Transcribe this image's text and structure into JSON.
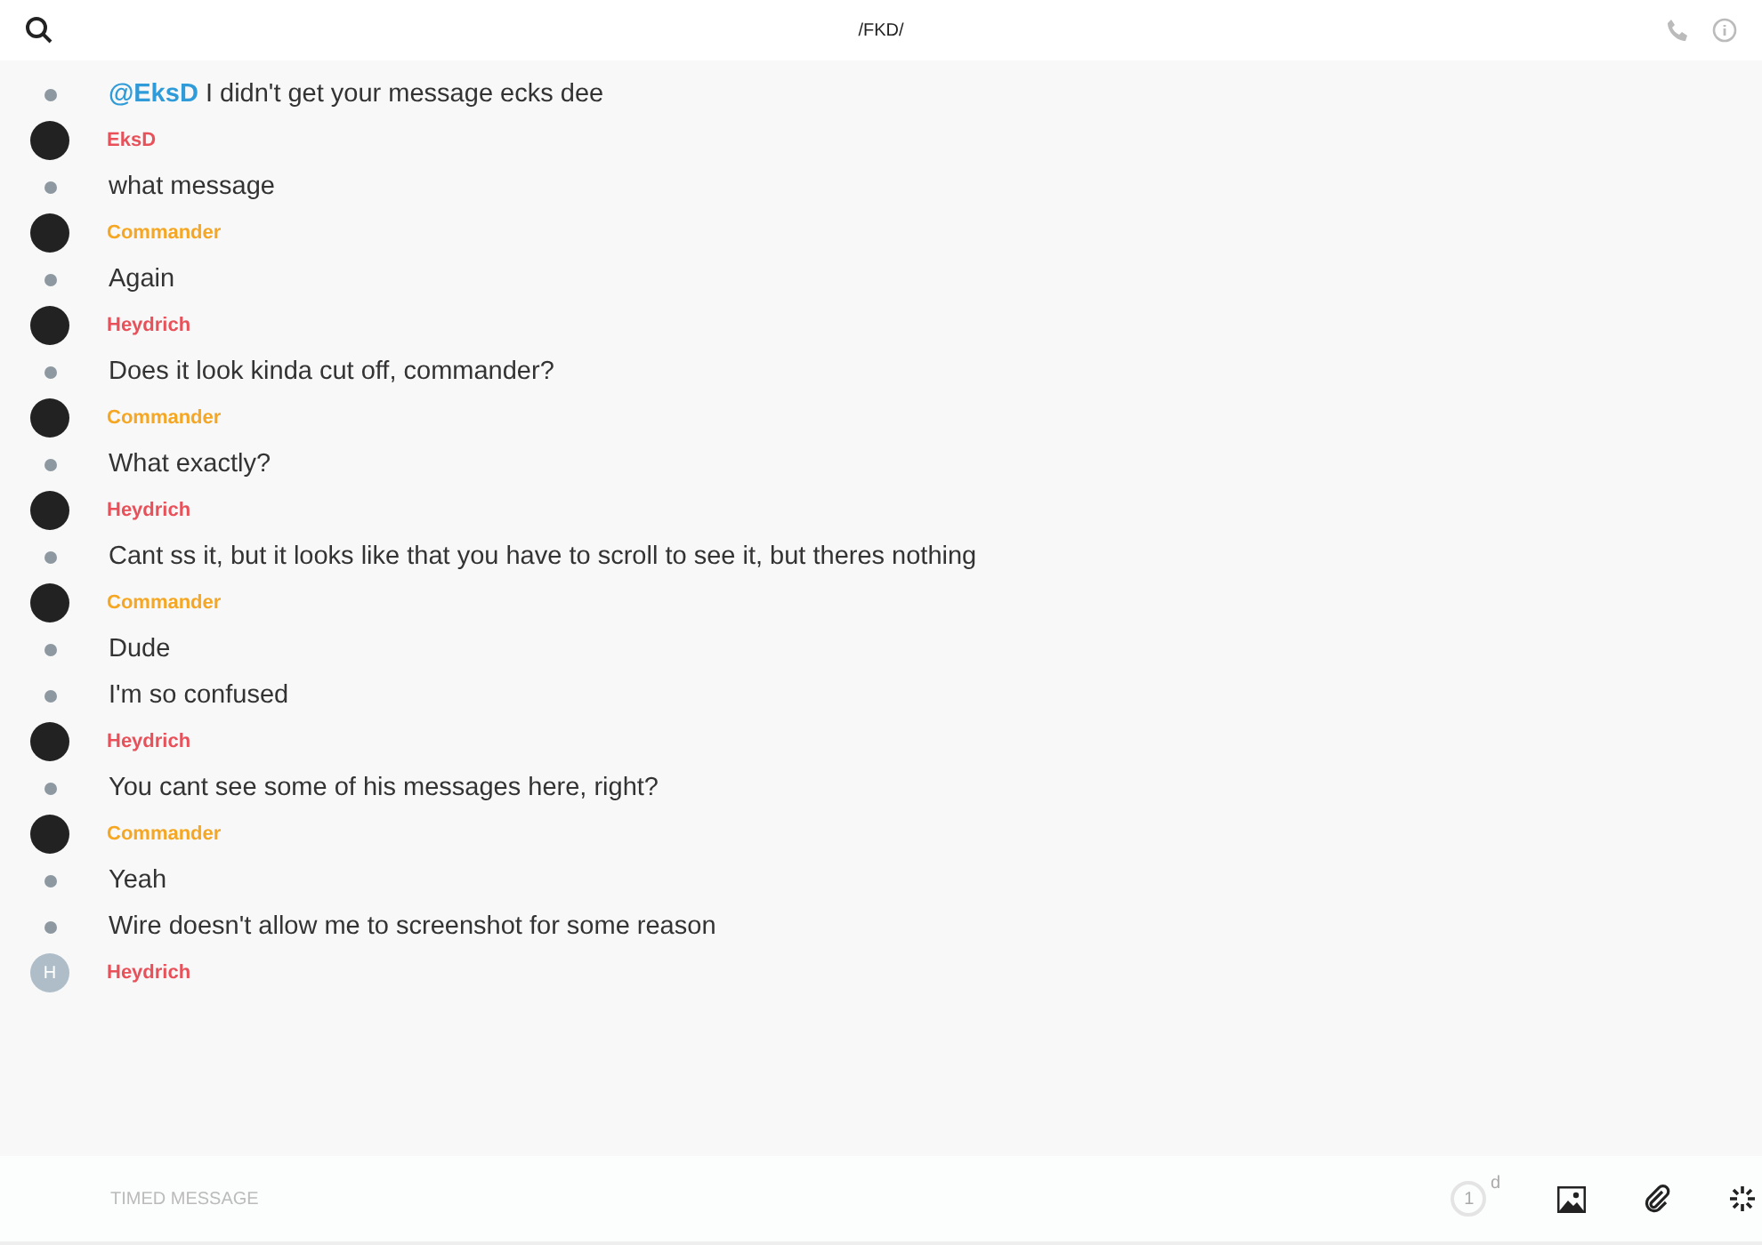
{
  "header": {
    "title": "/FKD/"
  },
  "messages": [
    {
      "mention": "@EksD",
      "text": "I didn't get your message ecks dee"
    },
    {
      "author": {
        "name": "EksD",
        "color": "#e8515a"
      },
      "text": "what message"
    },
    {
      "author": {
        "name": "Commander",
        "color": "#f5a623"
      },
      "text": "Again"
    },
    {
      "author": {
        "name": "Heydrich",
        "color": "#e8515a"
      },
      "text": "Does it look kinda cut off, commander?"
    },
    {
      "author": {
        "name": "Commander",
        "color": "#f5a623"
      },
      "text": "What exactly?"
    },
    {
      "author": {
        "name": "Heydrich",
        "color": "#e8515a"
      },
      "text": "Cant ss it, but it looks like that you have to scroll to see it, but theres nothing"
    },
    {
      "author": {
        "name": "Commander",
        "color": "#f5a623"
      },
      "text": "Dude"
    },
    {
      "text": "I'm so confused"
    },
    {
      "author": {
        "name": "Heydrich",
        "color": "#e8515a"
      },
      "text": "You cant see some of his messages here, right?"
    },
    {
      "author": {
        "name": "Commander",
        "color": "#f5a623"
      },
      "text": "Yeah"
    },
    {
      "text": "Wire doesn't allow me to screenshot for some reason"
    },
    {
      "author": {
        "name": "Heydrich",
        "color": "#e8515a",
        "avatar_letter": "H"
      }
    }
  ],
  "composer": {
    "placeholder": "TIMED MESSAGE",
    "timer": "1",
    "timer_unit": "d"
  }
}
